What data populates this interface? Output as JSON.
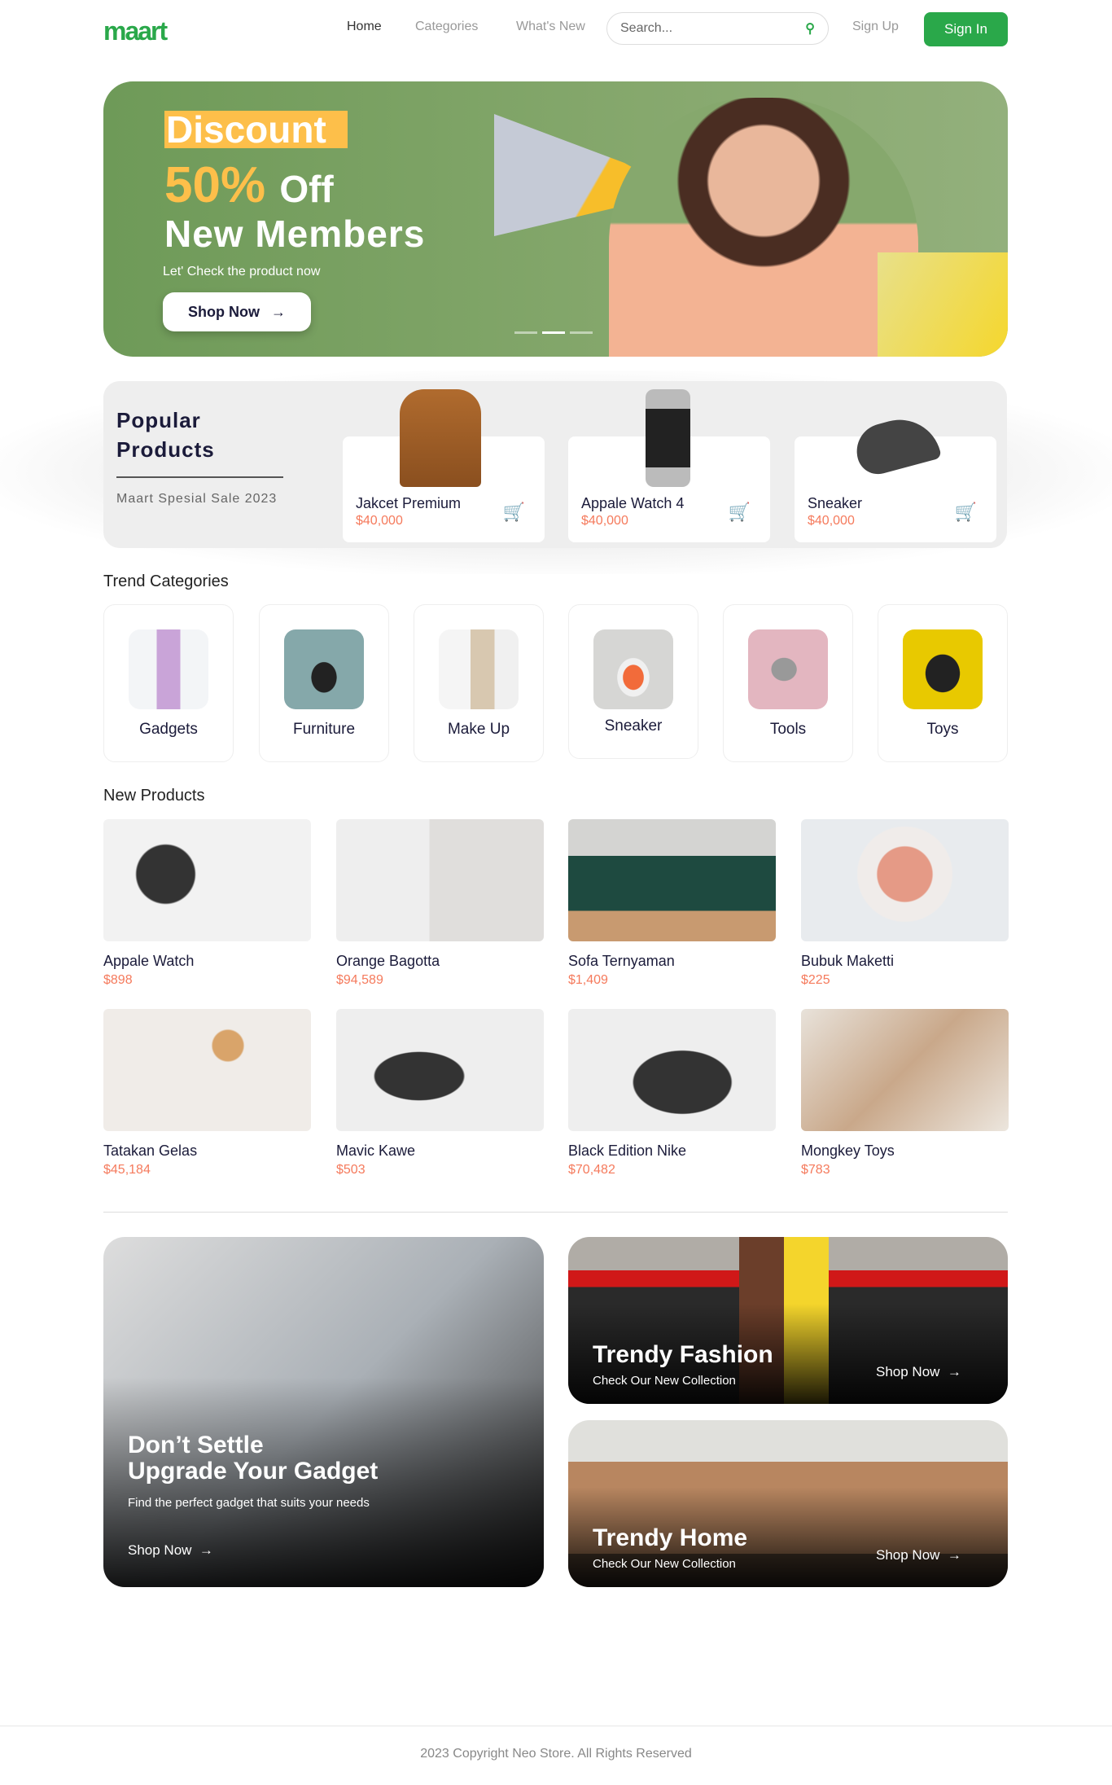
{
  "header": {
    "logo": "maart",
    "nav": [
      "Home",
      "Categories",
      "What's New"
    ],
    "search_placeholder": "Search...",
    "sign_up": "Sign Up",
    "sign_in": "Sign In"
  },
  "hero": {
    "discount": "Discount",
    "percent": "50%",
    "off": "Off",
    "members": "New Members",
    "tagline": "Let' Check the product now",
    "cta": "Shop Now",
    "slides": 3,
    "active_slide": 2
  },
  "popular": {
    "title_line1": "Popular",
    "title_line2": "Products",
    "subtitle": "Maart Spesial Sale 2023",
    "items": [
      {
        "name": "Jakcet Premium",
        "price": "$40,000"
      },
      {
        "name": "Appale Watch 4",
        "price": "$40,000"
      },
      {
        "name": "Sneaker",
        "price": "$40,000"
      }
    ]
  },
  "trend": {
    "title": "Trend Categories",
    "items": [
      "Gadgets",
      "Furniture",
      "Make Up",
      "Sneaker",
      "Tools",
      "Toys"
    ]
  },
  "new_products": {
    "title": "New Products",
    "items": [
      {
        "name": "Appale Watch",
        "price": "$898"
      },
      {
        "name": "Orange Bagotta",
        "price": "$94,589"
      },
      {
        "name": "Sofa Ternyaman",
        "price": "$1,409"
      },
      {
        "name": "Bubuk Maketti",
        "price": "$225"
      },
      {
        "name": "Tatakan Gelas",
        "price": "$45,184"
      },
      {
        "name": "Mavic Kawe",
        "price": "$503"
      },
      {
        "name": "Black Edition Nike",
        "price": "$70,482"
      },
      {
        "name": "Mongkey Toys",
        "price": "$783"
      }
    ]
  },
  "banners": {
    "gadget": {
      "line1": "Don’t Settle",
      "line2": "Upgrade Your Gadget",
      "sub": "Find the perfect gadget that suits your needs",
      "cta": "Shop Now"
    },
    "fashion": {
      "title": "Trendy Fashion",
      "sub": "Check Our New Collection",
      "cta": "Shop Now"
    },
    "home": {
      "title": "Trendy Home",
      "sub": "Check Our New Collection",
      "cta": "Shop Now"
    }
  },
  "footer": {
    "text": "2023 Copyright Neo Store. All Rights Reserved"
  },
  "colors": {
    "brand": "#2aa84a",
    "accent": "#fdbf4a",
    "price": "#f57a5c"
  }
}
